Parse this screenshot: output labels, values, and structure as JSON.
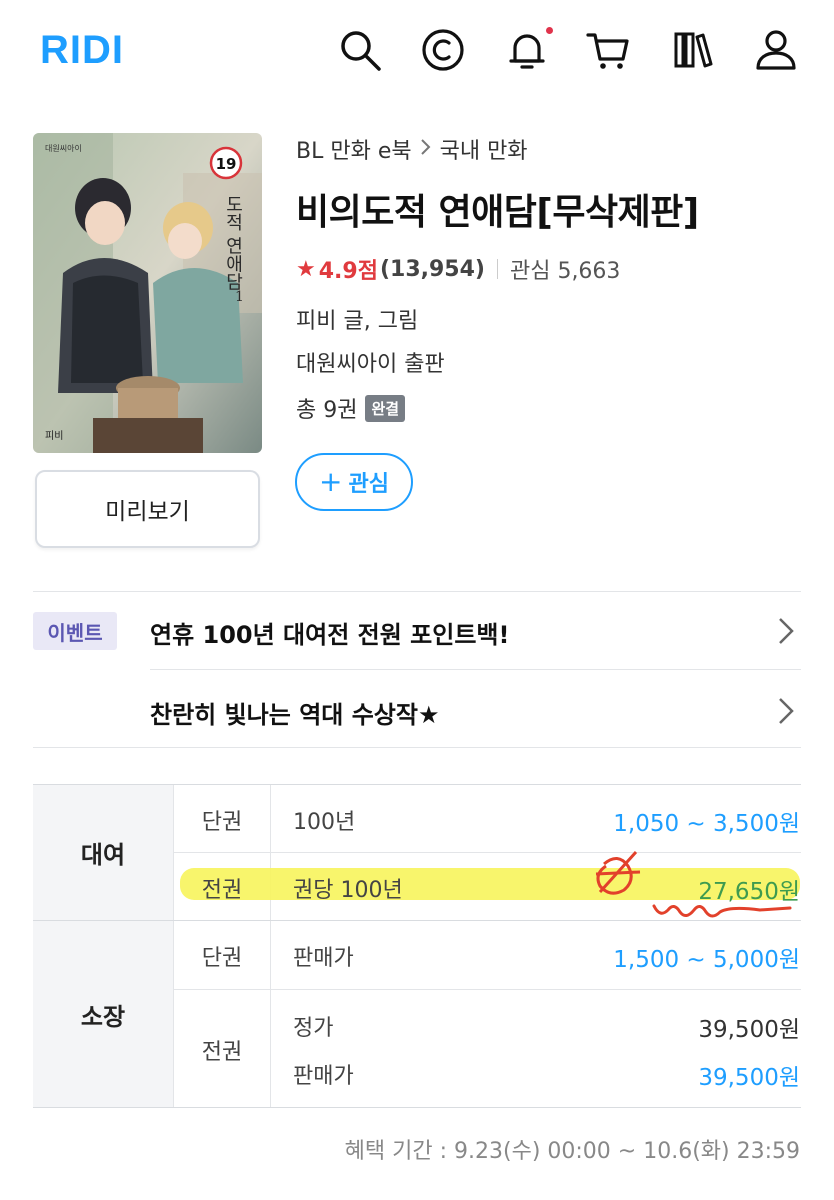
{
  "header": {
    "logo": "RIDI",
    "icons": [
      "search-icon",
      "cash-icon",
      "bell-icon",
      "cart-icon",
      "library-icon",
      "user-icon"
    ],
    "accent_color": "#1e9eff",
    "notification_dot_color": "#e0334b"
  },
  "book": {
    "cover_publisher_text": "대원씨아이",
    "cover_age_badge": "19",
    "cover_title_text": "도적 연애담",
    "cover_volume": "1",
    "cover_author_text": "피비",
    "preview_label": "미리보기",
    "breadcrumb": [
      "BL 만화 e북",
      "국내 만화"
    ],
    "title": "비의도적 연애담[무삭제판]",
    "rating_score": "4.9점",
    "rating_count": "(13,954)",
    "wishlist_text": "관심 5,663",
    "author": "피비 글, 그림",
    "publisher": "대원씨아이 출판",
    "volumes": "총 9권",
    "status_badge": "완결",
    "wish_button_label": "관심"
  },
  "events": {
    "badge": "이벤트",
    "items": [
      "연휴 100년 대여전 전원 포인트백!",
      "찬란히 빛나는 역대 수상작★"
    ]
  },
  "prices": {
    "rent": {
      "label": "대여",
      "rows": [
        {
          "type": "단권",
          "desc": "100년",
          "price": "1,050 ~ 3,500원"
        },
        {
          "type": "전권",
          "desc": "권당 100년",
          "price": "27,650원"
        }
      ]
    },
    "own": {
      "label": "소장",
      "rows": [
        {
          "type": "단권",
          "desc": "판매가",
          "price": "1,500 ~ 5,000원"
        },
        {
          "type": "전권",
          "list_label": "정가",
          "list_price": "39,500원",
          "sale_label": "판매가",
          "sale_price": "39,500원"
        }
      ]
    }
  },
  "benefit_period": "혜택 기간 : 9.23(수) 00:00 ~ 10.6(화) 23:59"
}
